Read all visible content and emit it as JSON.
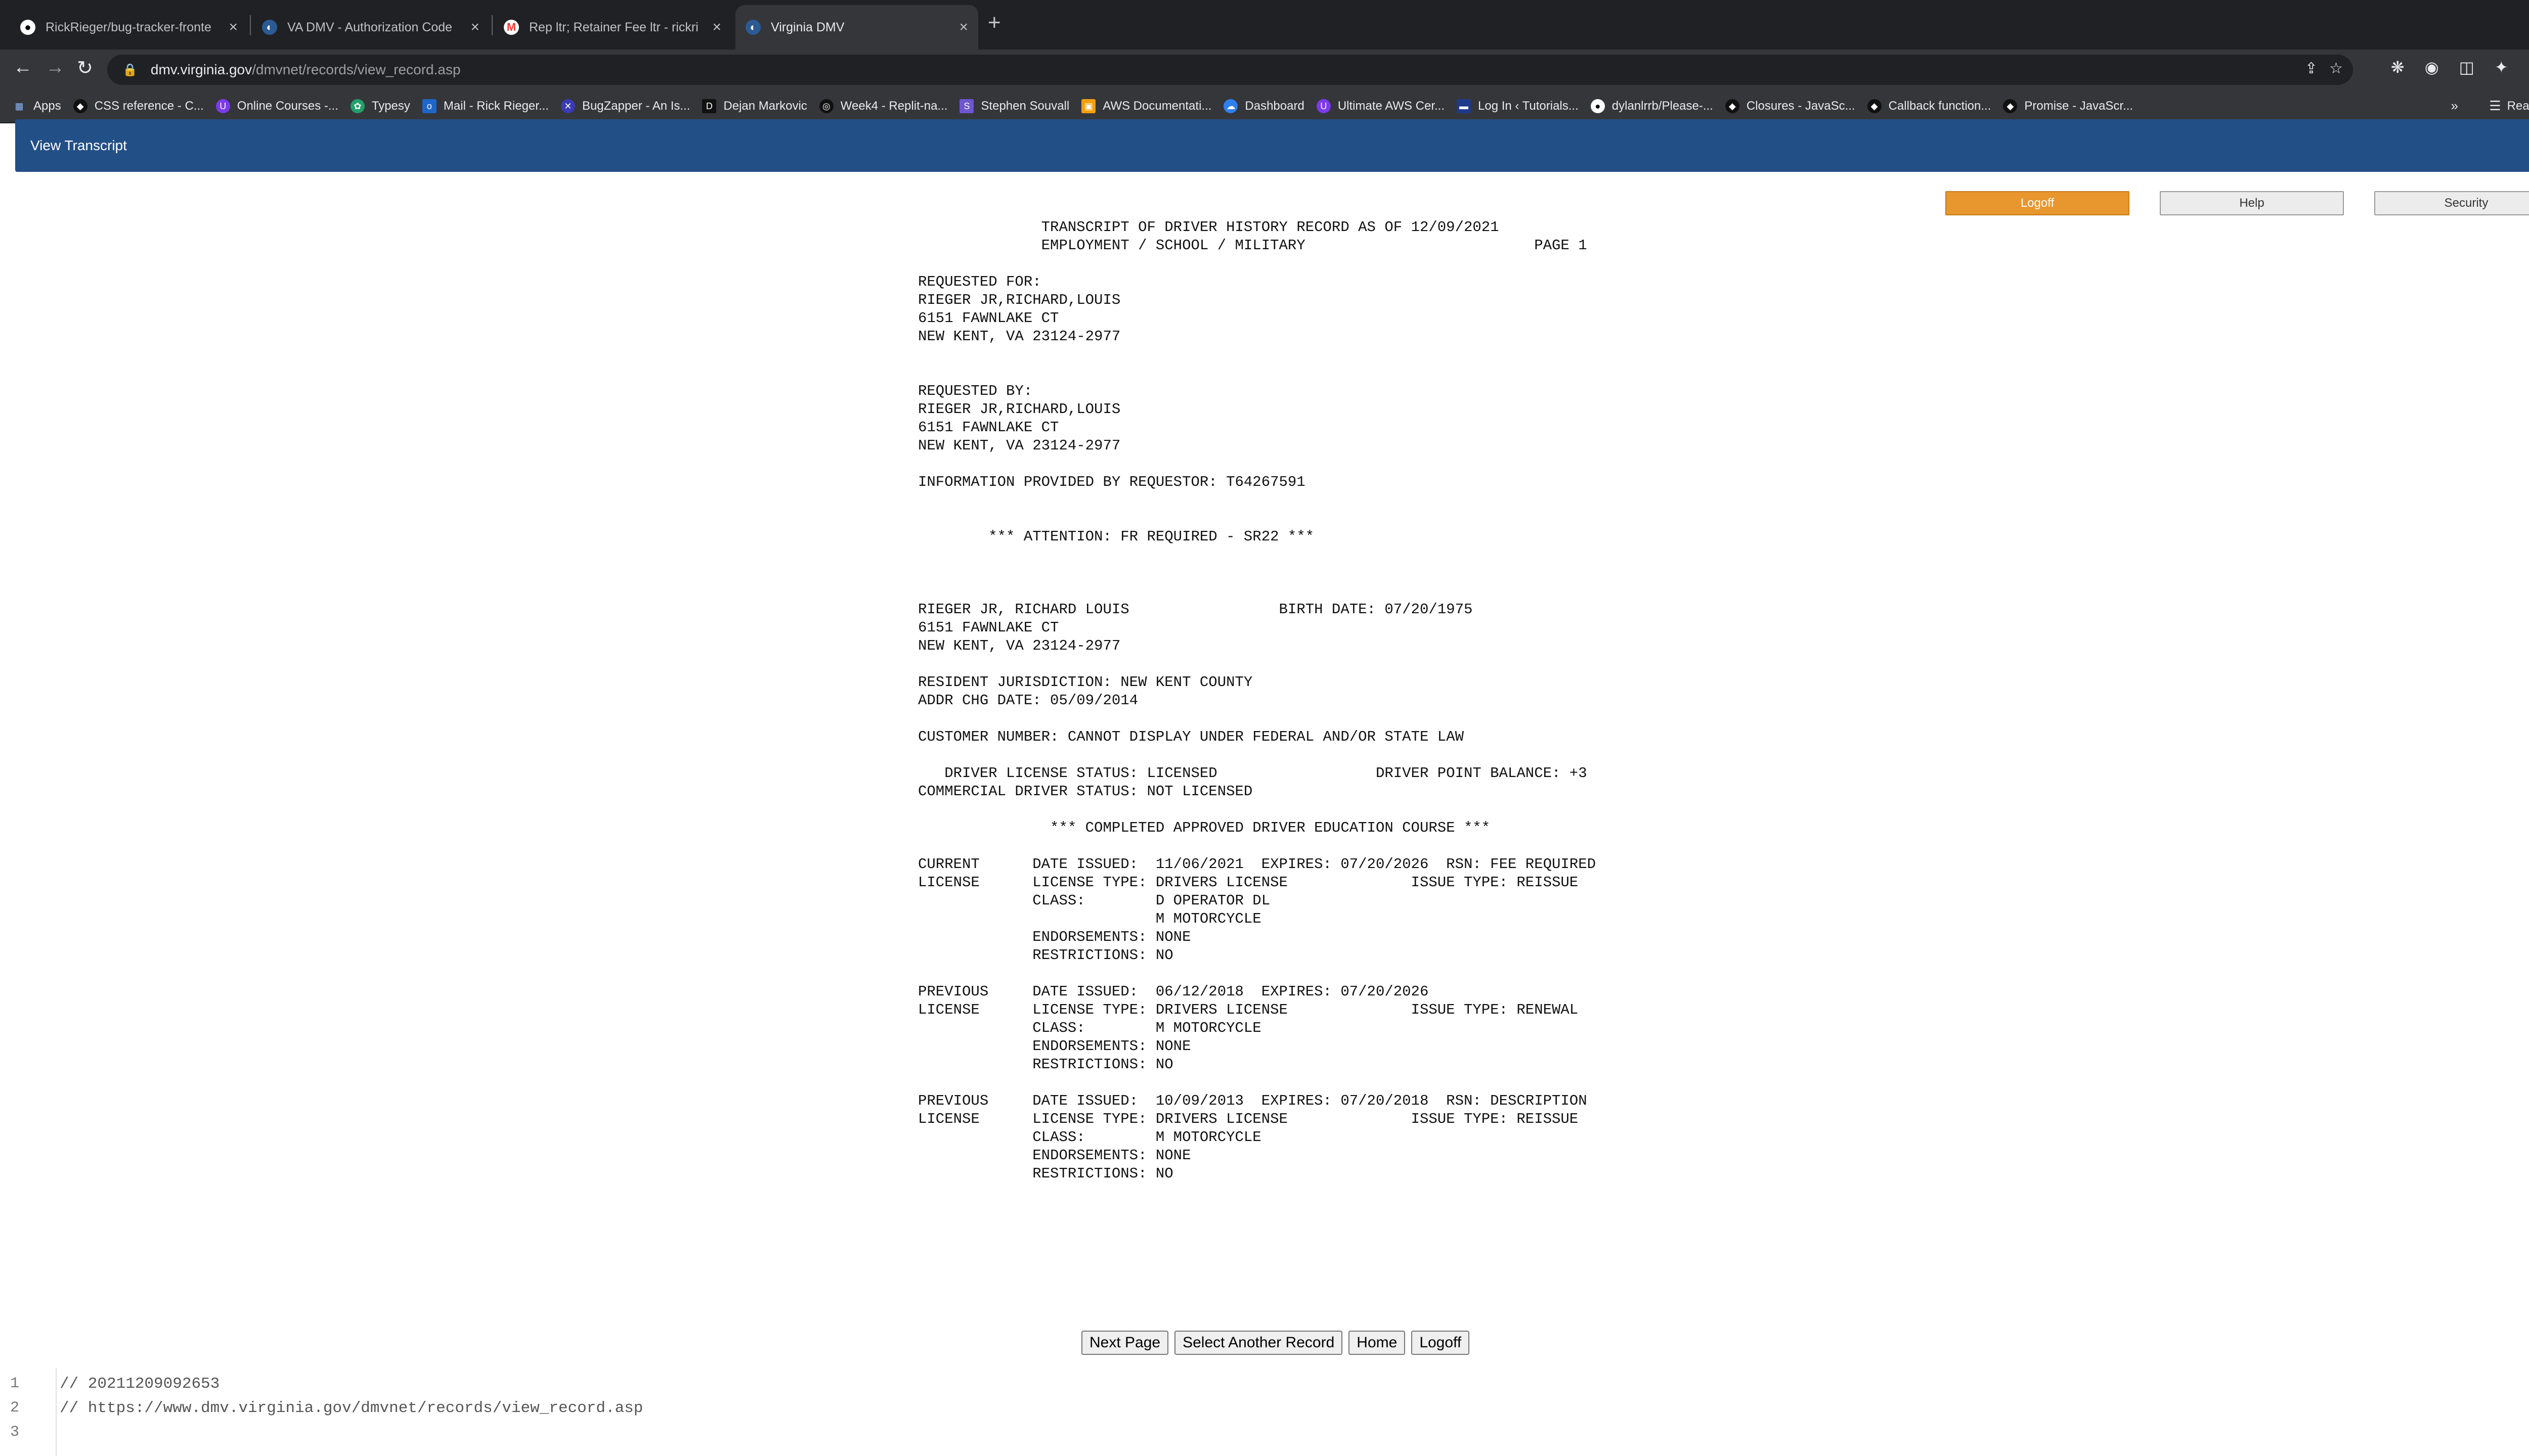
{
  "browser": {
    "tabs": [
      {
        "title": "RickRieger/bug-tracker-fronte",
        "icon": "github-icon",
        "active": false
      },
      {
        "title": "VA DMV - Authorization Code",
        "icon": "dmv-icon",
        "active": false
      },
      {
        "title": "Rep ltr; Retainer Fee ltr - rickri",
        "icon": "gmail-icon",
        "active": false
      },
      {
        "title": "Virginia DMV",
        "icon": "dmv-icon",
        "active": true
      }
    ],
    "url_host": "dmv.virginia.gov",
    "url_path": "/dmvnet/records/view_record.asp",
    "bookmarks": [
      {
        "label": "Apps",
        "icon": "apps-grid-icon",
        "color": "#8ab4f8"
      },
      {
        "label": "CSS reference - C...",
        "icon": "codecademy-icon",
        "color": "#111111"
      },
      {
        "label": "Online Courses -...",
        "icon": "udemy-icon",
        "color": "#7c3aed"
      },
      {
        "label": "Typesy",
        "icon": "typesy-icon",
        "color": "#22a06b"
      },
      {
        "label": "Mail - Rick Rieger...",
        "icon": "outlook-icon",
        "color": "#1e66c8"
      },
      {
        "label": "BugZapper - An Is...",
        "icon": "bugzapper-icon",
        "color": "#3b3bb5"
      },
      {
        "label": "Dejan Markovic",
        "icon": "d-icon",
        "color": "#111111"
      },
      {
        "label": "Week4 - Replit-na...",
        "icon": "replit-icon",
        "color": "#111111"
      },
      {
        "label": "Stephen Souvall",
        "icon": "s-icon",
        "color": "#6e56cf"
      },
      {
        "label": "AWS Documentati...",
        "icon": "aws-icon",
        "color": "#f59e0b"
      },
      {
        "label": "Dashboard",
        "icon": "cloud-icon",
        "color": "#2f80ed"
      },
      {
        "label": "Ultimate AWS Cer...",
        "icon": "udemy-icon",
        "color": "#7c3aed"
      },
      {
        "label": "Log In ‹ Tutorials...",
        "icon": "tutorials-icon",
        "color": "#1e3a8a"
      },
      {
        "label": "dylanlrrb/Please-...",
        "icon": "github-icon",
        "color": "#111111"
      },
      {
        "label": "Closures - JavaSc...",
        "icon": "codecademy-icon",
        "color": "#111111"
      },
      {
        "label": "Callback function...",
        "icon": "codecademy-icon",
        "color": "#111111"
      },
      {
        "label": "Promise - JavaScr...",
        "icon": "codecademy-icon",
        "color": "#111111"
      }
    ],
    "more_bookmarks": "»",
    "reading_list": "Reading List"
  },
  "page": {
    "header_title": "View Transcript",
    "top_buttons": {
      "logoff": "Logoff",
      "help": "Help",
      "security": "Security"
    },
    "transcript_text": "              TRANSCRIPT OF DRIVER HISTORY RECORD AS OF 12/09/2021\n              EMPLOYMENT / SCHOOL / MILITARY                          PAGE 1\n\nREQUESTED FOR:\nRIEGER JR,RICHARD,LOUIS\n6151 FAWNLAKE CT\nNEW KENT, VA 23124-2977\n\n\nREQUESTED BY:\nRIEGER JR,RICHARD,LOUIS\n6151 FAWNLAKE CT\nNEW KENT, VA 23124-2977\n\nINFORMATION PROVIDED BY REQUESTOR: T64267591\n\n\n        *** ATTENTION: FR REQUIRED - SR22 ***\n\n\n\nRIEGER JR, RICHARD LOUIS                 BIRTH DATE: 07/20/1975\n6151 FAWNLAKE CT\nNEW KENT, VA 23124-2977\n\nRESIDENT JURISDICTION: NEW KENT COUNTY\nADDR CHG DATE: 05/09/2014\n\nCUSTOMER NUMBER: CANNOT DISPLAY UNDER FEDERAL AND/OR STATE LAW\n\n   DRIVER LICENSE STATUS: LICENSED                  DRIVER POINT BALANCE: +3\nCOMMERCIAL DRIVER STATUS: NOT LICENSED\n\n               *** COMPLETED APPROVED DRIVER EDUCATION COURSE ***\n\nCURRENT      DATE ISSUED:  11/06/2021  EXPIRES: 07/20/2026  RSN: FEE REQUIRED\nLICENSE      LICENSE TYPE: DRIVERS LICENSE              ISSUE TYPE: REISSUE\n             CLASS:        D OPERATOR DL\n                           M MOTORCYCLE\n             ENDORSEMENTS: NONE\n             RESTRICTIONS: NO\n\nPREVIOUS     DATE ISSUED:  06/12/2018  EXPIRES: 07/20/2026\nLICENSE      LICENSE TYPE: DRIVERS LICENSE              ISSUE TYPE: RENEWAL\n             CLASS:        M MOTORCYCLE\n             ENDORSEMENTS: NONE\n             RESTRICTIONS: NO\n\nPREVIOUS     DATE ISSUED:  10/09/2013  EXPIRES: 07/20/2018  RSN: DESCRIPTION\nLICENSE      LICENSE TYPE: DRIVERS LICENSE              ISSUE TYPE: REISSUE\n             CLASS:        M MOTORCYCLE\n             ENDORSEMENTS: NONE\n             RESTRICTIONS: NO",
    "bottom_buttons": {
      "next_page": "Next Page",
      "select_another": "Select Another Record",
      "home": "Home",
      "logoff": "Logoff"
    }
  },
  "editor": {
    "line_numbers": [
      "1",
      "2",
      "3"
    ],
    "lines": [
      "// 20211209092653",
      "// https://www.dmv.virginia.gov/dmvnet/records/view_record.asp"
    ]
  }
}
